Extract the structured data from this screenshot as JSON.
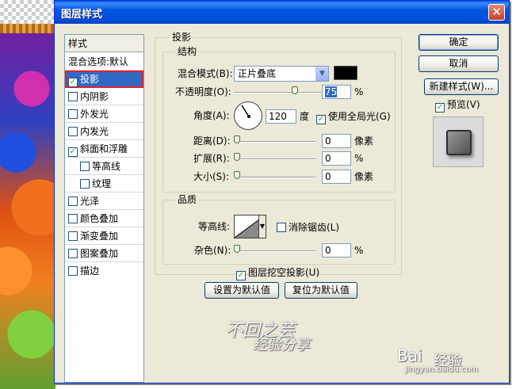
{
  "window": {
    "title": "图层样式",
    "close_icon": "close-icon"
  },
  "styles_panel": {
    "header": "样式",
    "items": [
      {
        "label": "混合选项:默认",
        "checkbox": false,
        "checked": false
      },
      {
        "label": "投影",
        "checkbox": true,
        "checked": true,
        "selected": true
      },
      {
        "label": "内阴影",
        "checkbox": true,
        "checked": false
      },
      {
        "label": "外发光",
        "checkbox": true,
        "checked": false
      },
      {
        "label": "内发光",
        "checkbox": true,
        "checked": false
      },
      {
        "label": "斜面和浮雕",
        "checkbox": true,
        "checked": true
      },
      {
        "label": "等高线",
        "checkbox": true,
        "checked": false,
        "indent": true
      },
      {
        "label": "纹理",
        "checkbox": true,
        "checked": false,
        "indent": true
      },
      {
        "label": "光泽",
        "checkbox": true,
        "checked": false
      },
      {
        "label": "颜色叠加",
        "checkbox": true,
        "checked": false
      },
      {
        "label": "渐变叠加",
        "checkbox": true,
        "checked": false
      },
      {
        "label": "图案叠加",
        "checkbox": true,
        "checked": false
      },
      {
        "label": "描边",
        "checkbox": true,
        "checked": false
      }
    ]
  },
  "drop_shadow": {
    "title": "投影",
    "structure": {
      "title": "结构",
      "blend_mode_label": "混合模式(B):",
      "blend_mode_value": "正片叠底",
      "blend_color": "#000000",
      "opacity_label": "不透明度(O):",
      "opacity_value": "75",
      "opacity_unit": "%",
      "opacity_slider": 0.75,
      "angle_label": "角度(A):",
      "angle_value": "120",
      "angle_unit": "度",
      "global_light_label": "使用全局光(G)",
      "global_light_checked": true,
      "distance_label": "距离(D):",
      "distance_value": "0",
      "distance_unit": "像素",
      "spread_label": "扩展(R):",
      "spread_value": "0",
      "spread_unit": "%",
      "size_label": "大小(S):",
      "size_value": "0",
      "size_unit": "像素"
    },
    "quality": {
      "title": "品质",
      "contour_label": "等高线:",
      "anti_alias_label": "消除锯齿(L)",
      "anti_alias_checked": false,
      "noise_label": "杂色(N):",
      "noise_value": "0",
      "noise_unit": "%"
    },
    "knockout_label": "图层挖空投影(U)",
    "knockout_checked": true,
    "set_default_label": "设置为默认值",
    "reset_default_label": "复位为默认值"
  },
  "buttons": {
    "ok": "确定",
    "cancel": "取消",
    "new_style": "新建样式(W)...",
    "preview_label": "预览(V)",
    "preview_checked": true
  },
  "watermark": {
    "left_text": "不回之芸",
    "line2": "经验分享",
    "baidu": "Bai",
    "baidu_suffix": "经验",
    "url": "jingyan.baidu.com"
  }
}
